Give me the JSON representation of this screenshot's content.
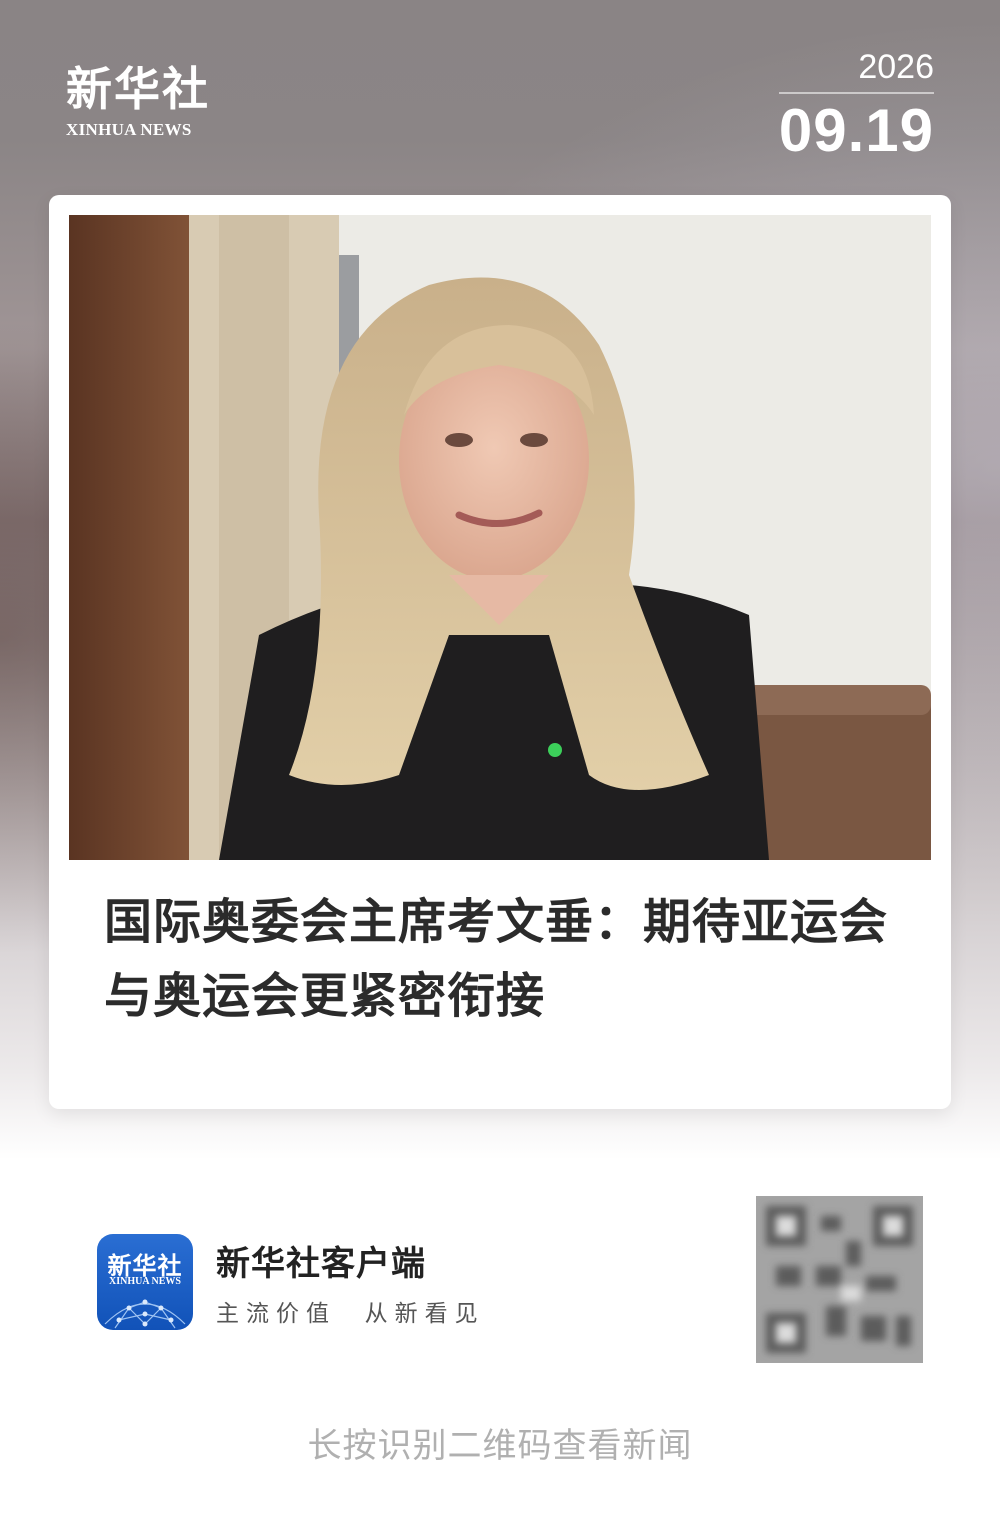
{
  "header": {
    "logo_cn": "新华社",
    "logo_en": "XINHUA NEWS",
    "year": "2026",
    "month_day": "09.19"
  },
  "article": {
    "headline": "国际奥委会主席考文垂：期待亚运会与奥运会更紧密衔接"
  },
  "brand": {
    "icon_cn": "新华社",
    "icon_en": "XINHUA NEWS",
    "name": "新华社客户端",
    "slogan": "主流价值  从新看见"
  },
  "footer": {
    "hint": "长按识别二维码查看新闻"
  },
  "colors": {
    "brand_blue": "#1a5fc6",
    "headline": "#2b2b2b",
    "hint_gray": "#b0b0b0"
  }
}
